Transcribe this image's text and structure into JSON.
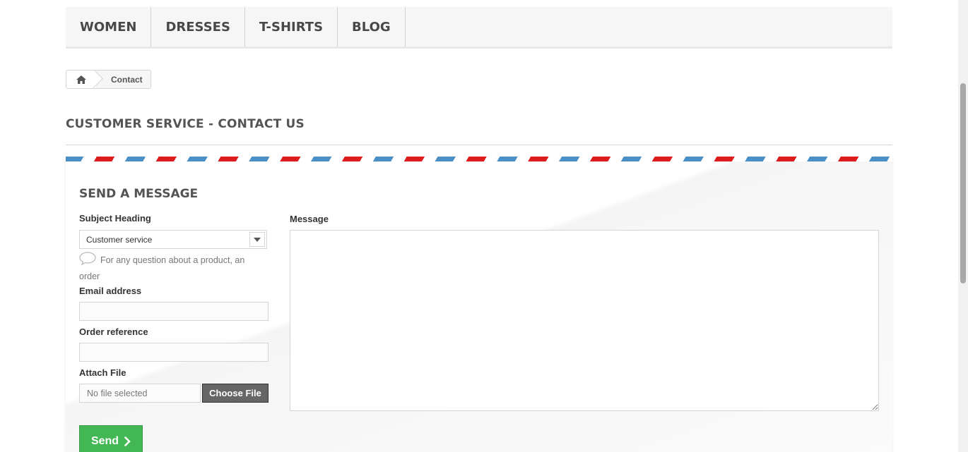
{
  "menu": {
    "items": [
      {
        "label": "WOMEN"
      },
      {
        "label": "DRESSES"
      },
      {
        "label": "T-SHIRTS"
      },
      {
        "label": "BLOG"
      }
    ]
  },
  "breadcrumb": {
    "home_icon": "home-icon",
    "current": "Contact"
  },
  "page_heading": "CUSTOMER SERVICE - CONTACT US",
  "form": {
    "title": "SEND A MESSAGE",
    "subject_label": "Subject Heading",
    "subject_value": "Customer service",
    "subject_hint": "For any question about a product, an order",
    "email_label": "Email address",
    "email_value": "",
    "order_label": "Order reference",
    "order_value": "",
    "attach_label": "Attach File",
    "file_status": "No file selected",
    "file_button": "Choose File",
    "message_label": "Message",
    "message_value": "",
    "send_label": "Send"
  },
  "colors": {
    "send_button": "#43b754",
    "stripe_blue": "#4a90c7",
    "stripe_red": "#dd1c1d"
  }
}
